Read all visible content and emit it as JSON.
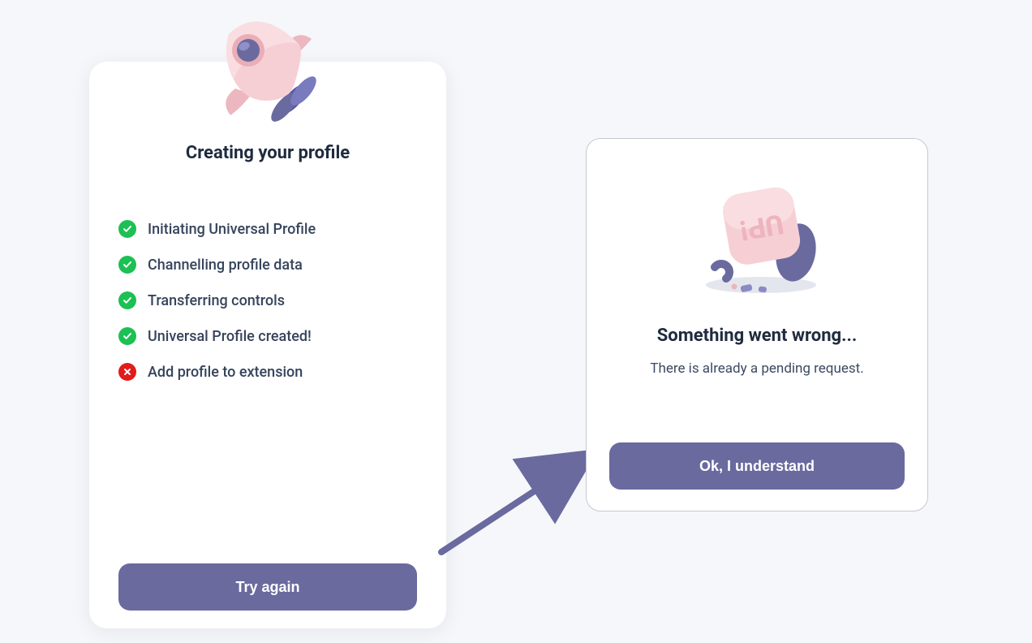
{
  "colors": {
    "accent": "#6a6a9f",
    "success": "#1cc053",
    "error": "#e21b1b",
    "text_primary": "#1f2b3e",
    "text_secondary": "#36445c",
    "bg": "#f5f7fa"
  },
  "profile_card": {
    "title": "Creating your profile",
    "steps": [
      {
        "label": "Initiating Universal Profile",
        "status": "success"
      },
      {
        "label": "Channelling profile data",
        "status": "success"
      },
      {
        "label": "Transferring controls",
        "status": "success"
      },
      {
        "label": "Universal Profile created!",
        "status": "success"
      },
      {
        "label": "Add profile to extension",
        "status": "error"
      }
    ],
    "cta": "Try again"
  },
  "error_card": {
    "title": "Something went wrong...",
    "message": "There is already a pending request.",
    "cta": "Ok, I understand"
  },
  "icons": {
    "rocket": "rocket-icon",
    "error_block": "error-block-icon",
    "arrow": "arrow-icon"
  }
}
